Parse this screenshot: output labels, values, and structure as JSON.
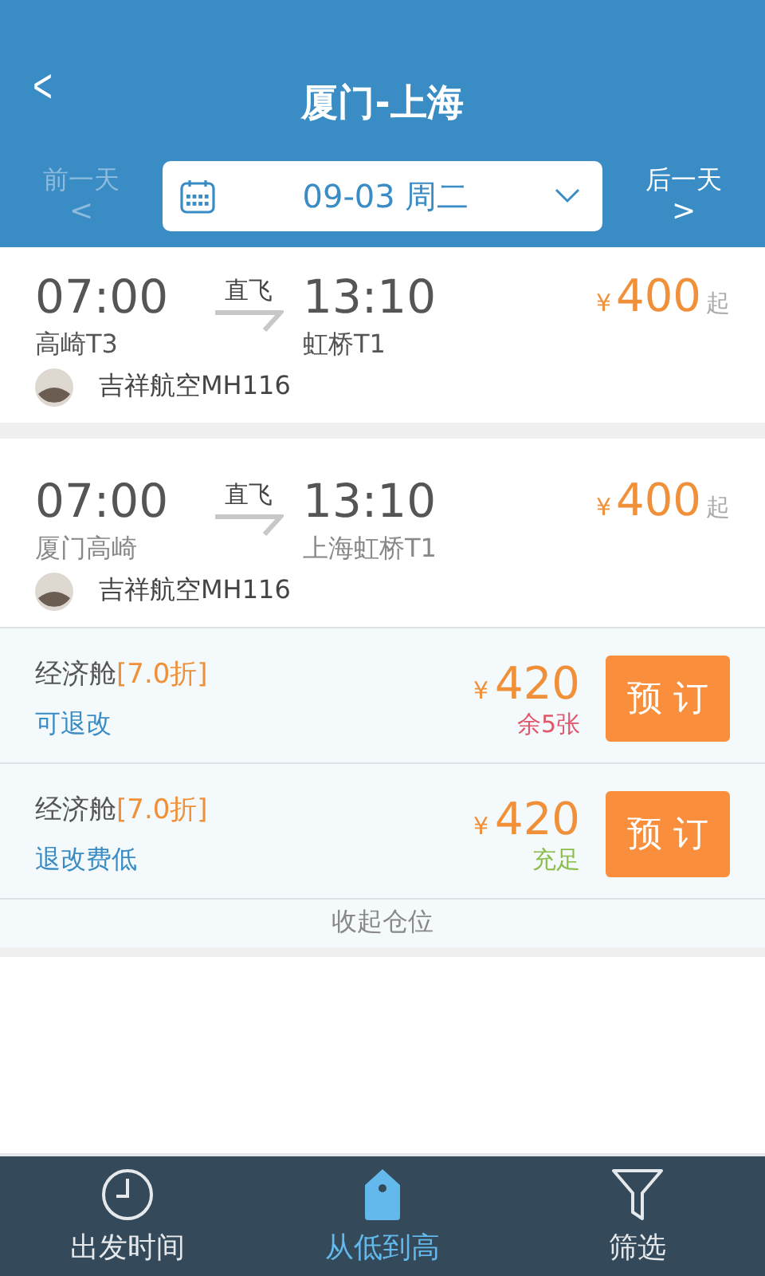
{
  "header": {
    "back": "<",
    "title": "厦门-上海"
  },
  "date_bar": {
    "prev": {
      "label": "前一天",
      "arrow": "<",
      "disabled": true
    },
    "date": "09-03  周二",
    "next": {
      "label": "后一天",
      "arrow": ">",
      "disabled": false
    }
  },
  "flights": [
    {
      "depart_time": "07:00",
      "type": "直飞",
      "arrive_time": "13:10",
      "depart_airport": "高崎T3",
      "arrive_airport": "虹桥T1",
      "airline": "吉祥航空MH116",
      "currency": "¥",
      "price": "400",
      "suffix": "起",
      "expanded": false
    },
    {
      "depart_time": "07:00",
      "type": "直飞",
      "arrive_time": "13:10",
      "depart_airport": "厦门高崎",
      "arrive_airport": "上海虹桥T1",
      "airline": "吉祥航空MH116",
      "currency": "¥",
      "price": "400",
      "suffix": "起",
      "expanded": true,
      "fares": [
        {
          "cabin": "经济舱",
          "discount": "[7.0折]",
          "policy": "可退改",
          "currency": "¥",
          "price": "420",
          "stock": "余5张",
          "color": "#e0566a",
          "button": "预 订"
        },
        {
          "cabin": "经济舱",
          "discount": "[7.0折]",
          "policy": "退改费低",
          "currency": "¥",
          "price": "420",
          "stock": "充足",
          "color": "#8cbd4a",
          "button": "预 订"
        }
      ],
      "collapse": "收起仓位"
    }
  ],
  "tabbar": [
    {
      "label": "出发时间",
      "kind": "clock",
      "selected": false
    },
    {
      "label": "从低到高",
      "kind": "tag",
      "selected": true
    },
    {
      "label": "筛选",
      "kind": "filter",
      "selected": false
    }
  ]
}
